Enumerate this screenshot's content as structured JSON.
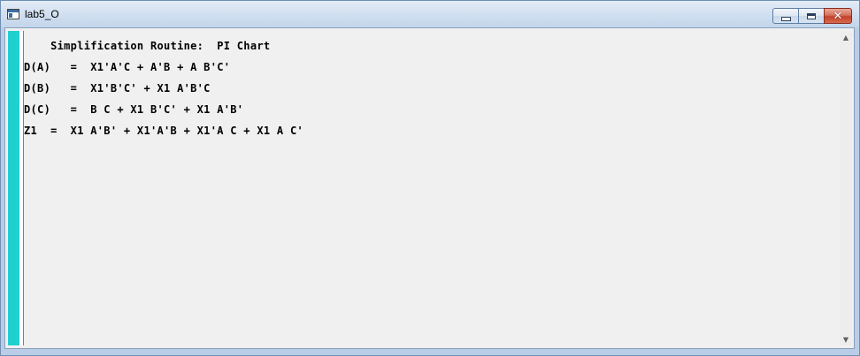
{
  "window": {
    "title": "lab5_O"
  },
  "caption": {
    "minimize_icon": "minimize-icon",
    "maximize_icon": "maximize-icon",
    "close_glyph": "✕"
  },
  "output": {
    "lines": [
      "    Simplification Routine:  PI Chart",
      "D(A)   =  X1'A'C + A'B + A B'C'",
      "D(B)   =  X1'B'C' + X1 A'B'C",
      "D(C)   =  B C + X1 B'C' + X1 A'B'",
      "Z1  =  X1 A'B' + X1'A'B + X1'A C + X1 A C'"
    ]
  },
  "scrollbar": {
    "up_arrow": "▲",
    "down_arrow": "▼"
  },
  "colors": {
    "accent_bar": "#1fd0cf",
    "background": "#f0f0f0"
  }
}
